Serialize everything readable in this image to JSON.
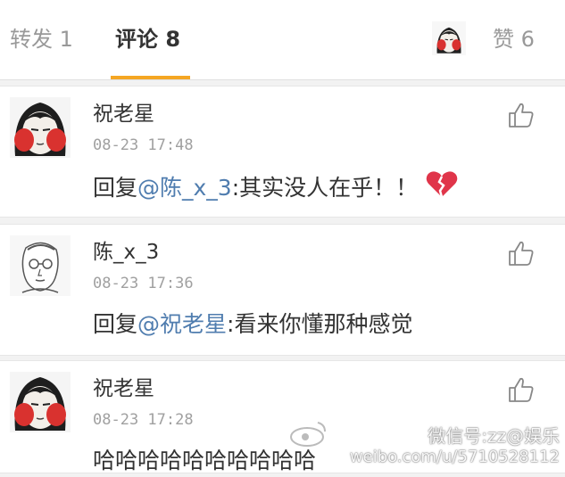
{
  "tabs": {
    "repost_label": "转发 1",
    "comment_label": "评论 8",
    "like_label": "赞 6"
  },
  "comments": [
    {
      "username": "祝老星",
      "time": "08-23 17:48",
      "text_prefix": "回复",
      "mention": "@陈_x_3",
      "text_rest": ":其实没人在乎！！",
      "emoji": "broken-heart-icon"
    },
    {
      "username": "陈_x_3",
      "time": "08-23 17:36",
      "text_prefix": "回复",
      "mention": "@祝老星",
      "text_rest": ":看来你懂那种感觉"
    },
    {
      "username": "祝老星",
      "time": "08-23 17:28",
      "text": "哈哈哈哈哈哈哈哈哈哈"
    }
  ],
  "watermark": {
    "line1": "微信号:zz@娱乐",
    "line2": "weibo.com/u/5710528112"
  },
  "colors": {
    "accent_underline": "#f5a623",
    "mention": "#507daf",
    "heart": "#e0354a",
    "avatar_cheek": "#d9322f"
  }
}
